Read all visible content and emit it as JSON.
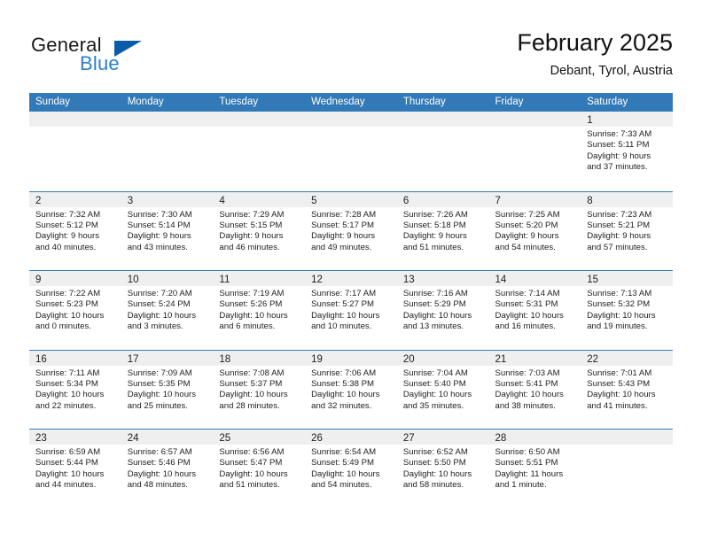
{
  "brand": {
    "name_part1": "General",
    "name_part2": "Blue",
    "logo_icon": "blue-triangle-logo",
    "color_dark": "#1a1a1a",
    "color_blue": "#2a7fc9",
    "triangle_color": "#0a5ca8"
  },
  "header": {
    "title": "February 2025",
    "subtitle": "Debant, Tyrol, Austria"
  },
  "theme": {
    "header_row_bg": "#3279b7",
    "header_row_text": "#ffffff",
    "day_strip_bg": "#efefef",
    "row_divider": "#3279b7",
    "body_text": "#222222"
  },
  "weekdays": [
    "Sunday",
    "Monday",
    "Tuesday",
    "Wednesday",
    "Thursday",
    "Friday",
    "Saturday"
  ],
  "weeks": [
    [
      {
        "day": "",
        "sunrise": "",
        "sunset": "",
        "daylight_line1": "",
        "daylight_line2": "",
        "empty": true
      },
      {
        "day": "",
        "sunrise": "",
        "sunset": "",
        "daylight_line1": "",
        "daylight_line2": "",
        "empty": true
      },
      {
        "day": "",
        "sunrise": "",
        "sunset": "",
        "daylight_line1": "",
        "daylight_line2": "",
        "empty": true
      },
      {
        "day": "",
        "sunrise": "",
        "sunset": "",
        "daylight_line1": "",
        "daylight_line2": "",
        "empty": true
      },
      {
        "day": "",
        "sunrise": "",
        "sunset": "",
        "daylight_line1": "",
        "daylight_line2": "",
        "empty": true
      },
      {
        "day": "",
        "sunrise": "",
        "sunset": "",
        "daylight_line1": "",
        "daylight_line2": "",
        "empty": true
      },
      {
        "day": "1",
        "sunrise": "Sunrise: 7:33 AM",
        "sunset": "Sunset: 5:11 PM",
        "daylight_line1": "Daylight: 9 hours",
        "daylight_line2": "and 37 minutes.",
        "empty": false
      }
    ],
    [
      {
        "day": "2",
        "sunrise": "Sunrise: 7:32 AM",
        "sunset": "Sunset: 5:12 PM",
        "daylight_line1": "Daylight: 9 hours",
        "daylight_line2": "and 40 minutes.",
        "empty": false
      },
      {
        "day": "3",
        "sunrise": "Sunrise: 7:30 AM",
        "sunset": "Sunset: 5:14 PM",
        "daylight_line1": "Daylight: 9 hours",
        "daylight_line2": "and 43 minutes.",
        "empty": false
      },
      {
        "day": "4",
        "sunrise": "Sunrise: 7:29 AM",
        "sunset": "Sunset: 5:15 PM",
        "daylight_line1": "Daylight: 9 hours",
        "daylight_line2": "and 46 minutes.",
        "empty": false
      },
      {
        "day": "5",
        "sunrise": "Sunrise: 7:28 AM",
        "sunset": "Sunset: 5:17 PM",
        "daylight_line1": "Daylight: 9 hours",
        "daylight_line2": "and 49 minutes.",
        "empty": false
      },
      {
        "day": "6",
        "sunrise": "Sunrise: 7:26 AM",
        "sunset": "Sunset: 5:18 PM",
        "daylight_line1": "Daylight: 9 hours",
        "daylight_line2": "and 51 minutes.",
        "empty": false
      },
      {
        "day": "7",
        "sunrise": "Sunrise: 7:25 AM",
        "sunset": "Sunset: 5:20 PM",
        "daylight_line1": "Daylight: 9 hours",
        "daylight_line2": "and 54 minutes.",
        "empty": false
      },
      {
        "day": "8",
        "sunrise": "Sunrise: 7:23 AM",
        "sunset": "Sunset: 5:21 PM",
        "daylight_line1": "Daylight: 9 hours",
        "daylight_line2": "and 57 minutes.",
        "empty": false
      }
    ],
    [
      {
        "day": "9",
        "sunrise": "Sunrise: 7:22 AM",
        "sunset": "Sunset: 5:23 PM",
        "daylight_line1": "Daylight: 10 hours",
        "daylight_line2": "and 0 minutes.",
        "empty": false
      },
      {
        "day": "10",
        "sunrise": "Sunrise: 7:20 AM",
        "sunset": "Sunset: 5:24 PM",
        "daylight_line1": "Daylight: 10 hours",
        "daylight_line2": "and 3 minutes.",
        "empty": false
      },
      {
        "day": "11",
        "sunrise": "Sunrise: 7:19 AM",
        "sunset": "Sunset: 5:26 PM",
        "daylight_line1": "Daylight: 10 hours",
        "daylight_line2": "and 6 minutes.",
        "empty": false
      },
      {
        "day": "12",
        "sunrise": "Sunrise: 7:17 AM",
        "sunset": "Sunset: 5:27 PM",
        "daylight_line1": "Daylight: 10 hours",
        "daylight_line2": "and 10 minutes.",
        "empty": false
      },
      {
        "day": "13",
        "sunrise": "Sunrise: 7:16 AM",
        "sunset": "Sunset: 5:29 PM",
        "daylight_line1": "Daylight: 10 hours",
        "daylight_line2": "and 13 minutes.",
        "empty": false
      },
      {
        "day": "14",
        "sunrise": "Sunrise: 7:14 AM",
        "sunset": "Sunset: 5:31 PM",
        "daylight_line1": "Daylight: 10 hours",
        "daylight_line2": "and 16 minutes.",
        "empty": false
      },
      {
        "day": "15",
        "sunrise": "Sunrise: 7:13 AM",
        "sunset": "Sunset: 5:32 PM",
        "daylight_line1": "Daylight: 10 hours",
        "daylight_line2": "and 19 minutes.",
        "empty": false
      }
    ],
    [
      {
        "day": "16",
        "sunrise": "Sunrise: 7:11 AM",
        "sunset": "Sunset: 5:34 PM",
        "daylight_line1": "Daylight: 10 hours",
        "daylight_line2": "and 22 minutes.",
        "empty": false
      },
      {
        "day": "17",
        "sunrise": "Sunrise: 7:09 AM",
        "sunset": "Sunset: 5:35 PM",
        "daylight_line1": "Daylight: 10 hours",
        "daylight_line2": "and 25 minutes.",
        "empty": false
      },
      {
        "day": "18",
        "sunrise": "Sunrise: 7:08 AM",
        "sunset": "Sunset: 5:37 PM",
        "daylight_line1": "Daylight: 10 hours",
        "daylight_line2": "and 28 minutes.",
        "empty": false
      },
      {
        "day": "19",
        "sunrise": "Sunrise: 7:06 AM",
        "sunset": "Sunset: 5:38 PM",
        "daylight_line1": "Daylight: 10 hours",
        "daylight_line2": "and 32 minutes.",
        "empty": false
      },
      {
        "day": "20",
        "sunrise": "Sunrise: 7:04 AM",
        "sunset": "Sunset: 5:40 PM",
        "daylight_line1": "Daylight: 10 hours",
        "daylight_line2": "and 35 minutes.",
        "empty": false
      },
      {
        "day": "21",
        "sunrise": "Sunrise: 7:03 AM",
        "sunset": "Sunset: 5:41 PM",
        "daylight_line1": "Daylight: 10 hours",
        "daylight_line2": "and 38 minutes.",
        "empty": false
      },
      {
        "day": "22",
        "sunrise": "Sunrise: 7:01 AM",
        "sunset": "Sunset: 5:43 PM",
        "daylight_line1": "Daylight: 10 hours",
        "daylight_line2": "and 41 minutes.",
        "empty": false
      }
    ],
    [
      {
        "day": "23",
        "sunrise": "Sunrise: 6:59 AM",
        "sunset": "Sunset: 5:44 PM",
        "daylight_line1": "Daylight: 10 hours",
        "daylight_line2": "and 44 minutes.",
        "empty": false
      },
      {
        "day": "24",
        "sunrise": "Sunrise: 6:57 AM",
        "sunset": "Sunset: 5:46 PM",
        "daylight_line1": "Daylight: 10 hours",
        "daylight_line2": "and 48 minutes.",
        "empty": false
      },
      {
        "day": "25",
        "sunrise": "Sunrise: 6:56 AM",
        "sunset": "Sunset: 5:47 PM",
        "daylight_line1": "Daylight: 10 hours",
        "daylight_line2": "and 51 minutes.",
        "empty": false
      },
      {
        "day": "26",
        "sunrise": "Sunrise: 6:54 AM",
        "sunset": "Sunset: 5:49 PM",
        "daylight_line1": "Daylight: 10 hours",
        "daylight_line2": "and 54 minutes.",
        "empty": false
      },
      {
        "day": "27",
        "sunrise": "Sunrise: 6:52 AM",
        "sunset": "Sunset: 5:50 PM",
        "daylight_line1": "Daylight: 10 hours",
        "daylight_line2": "and 58 minutes.",
        "empty": false
      },
      {
        "day": "28",
        "sunrise": "Sunrise: 6:50 AM",
        "sunset": "Sunset: 5:51 PM",
        "daylight_line1": "Daylight: 11 hours",
        "daylight_line2": "and 1 minute.",
        "empty": false
      },
      {
        "day": "",
        "sunrise": "",
        "sunset": "",
        "daylight_line1": "",
        "daylight_line2": "",
        "empty": true
      }
    ]
  ]
}
